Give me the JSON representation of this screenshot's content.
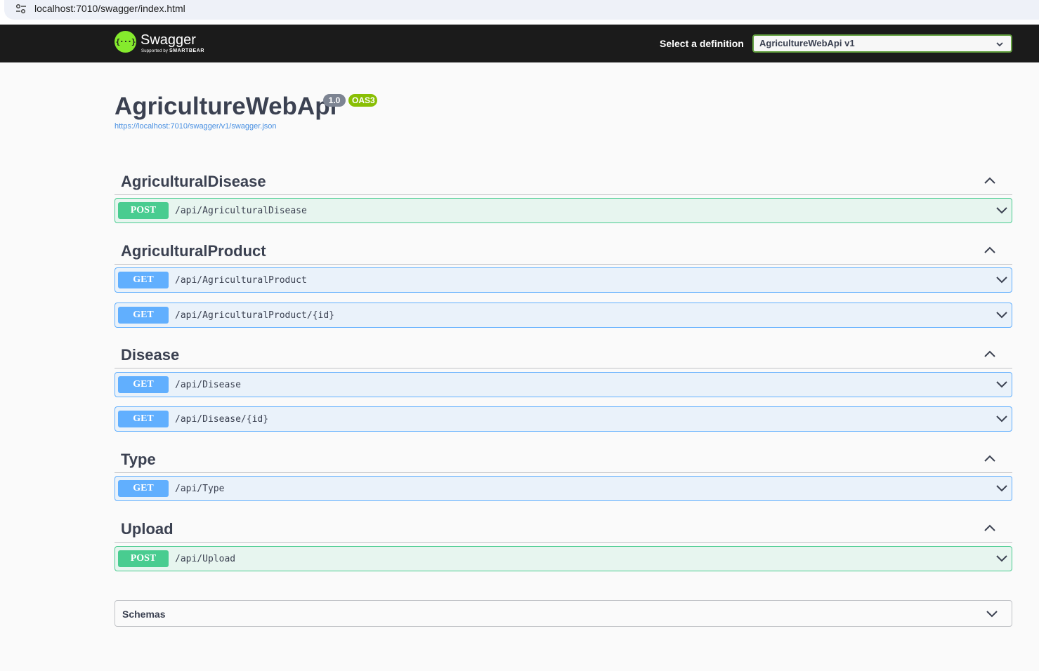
{
  "browser": {
    "url": "localhost:7010/swagger/index.html",
    "site_info_icon": "tune-icon"
  },
  "topbar": {
    "logo_icon": "swagger-logo-icon",
    "logo_glyph": "{···}",
    "logo_name": "Swagger",
    "logo_tagline_prefix": "Supported by",
    "logo_tagline_brand": "SMARTBEAR",
    "definition_label": "Select a definition",
    "definition_selected": "AgricultureWebApi v1"
  },
  "info": {
    "title": "AgricultureWebApi",
    "version": "1.0",
    "oas": "OAS3",
    "spec_url": "https://localhost:7010/swagger/v1/swagger.json"
  },
  "tags": [
    {
      "name": "AgriculturalDisease",
      "operations": [
        {
          "method": "POST",
          "path": "/api/AgriculturalDisease"
        }
      ]
    },
    {
      "name": "AgriculturalProduct",
      "operations": [
        {
          "method": "GET",
          "path": "/api/AgriculturalProduct"
        },
        {
          "method": "GET",
          "path": "/api/AgriculturalProduct/{id}"
        }
      ]
    },
    {
      "name": "Disease",
      "operations": [
        {
          "method": "GET",
          "path": "/api/Disease"
        },
        {
          "method": "GET",
          "path": "/api/Disease/{id}"
        }
      ]
    },
    {
      "name": "Type",
      "operations": [
        {
          "method": "GET",
          "path": "/api/Type"
        }
      ]
    },
    {
      "name": "Upload",
      "operations": [
        {
          "method": "POST",
          "path": "/api/Upload"
        }
      ]
    }
  ],
  "schemas": {
    "label": "Schemas"
  },
  "colors": {
    "get": "#61affe",
    "post": "#49cc90",
    "topbar": "#1b1b1b",
    "logo": "#85ea2d",
    "link": "#4990e2"
  }
}
